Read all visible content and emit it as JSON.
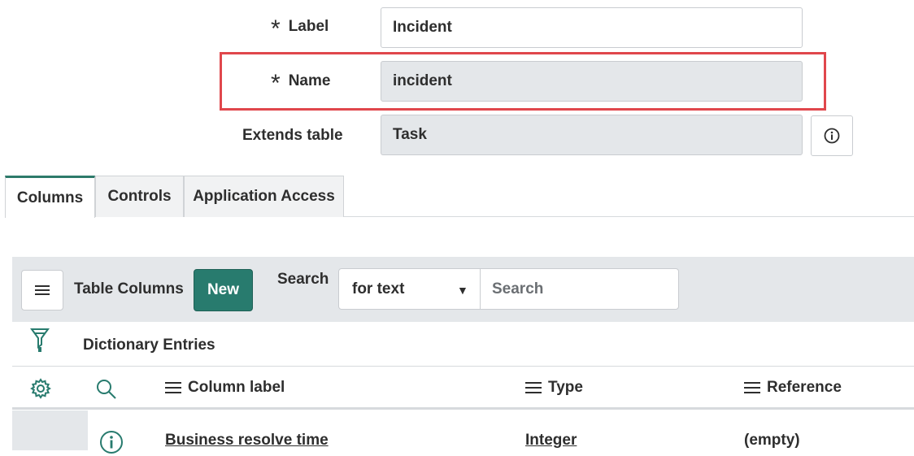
{
  "form": {
    "label_field": {
      "label": "Label",
      "value": "Incident",
      "required_mark": "*"
    },
    "name_field": {
      "label": "Name",
      "value": "incident",
      "required_mark": "*"
    },
    "extends_field": {
      "label": "Extends table",
      "value": "Task"
    }
  },
  "tabs": [
    {
      "label": "Columns",
      "active": true
    },
    {
      "label": "Controls",
      "active": false
    },
    {
      "label": "Application Access",
      "active": false
    }
  ],
  "toolbar": {
    "title": "Table Columns",
    "new_label": "New",
    "search_label": "Search",
    "search_field_selected": "for text",
    "search_placeholder": "Search"
  },
  "filter": {
    "breadcrumb": "Dictionary Entries"
  },
  "table": {
    "columns": [
      "Column label",
      "Type",
      "Reference"
    ],
    "rows": [
      {
        "column_label": "Business resolve time",
        "type": "Integer",
        "reference": "(empty)"
      }
    ]
  },
  "colors": {
    "accent": "#287b6e",
    "highlight": "#e0474c",
    "readonly_bg": "#e4e7ea"
  }
}
